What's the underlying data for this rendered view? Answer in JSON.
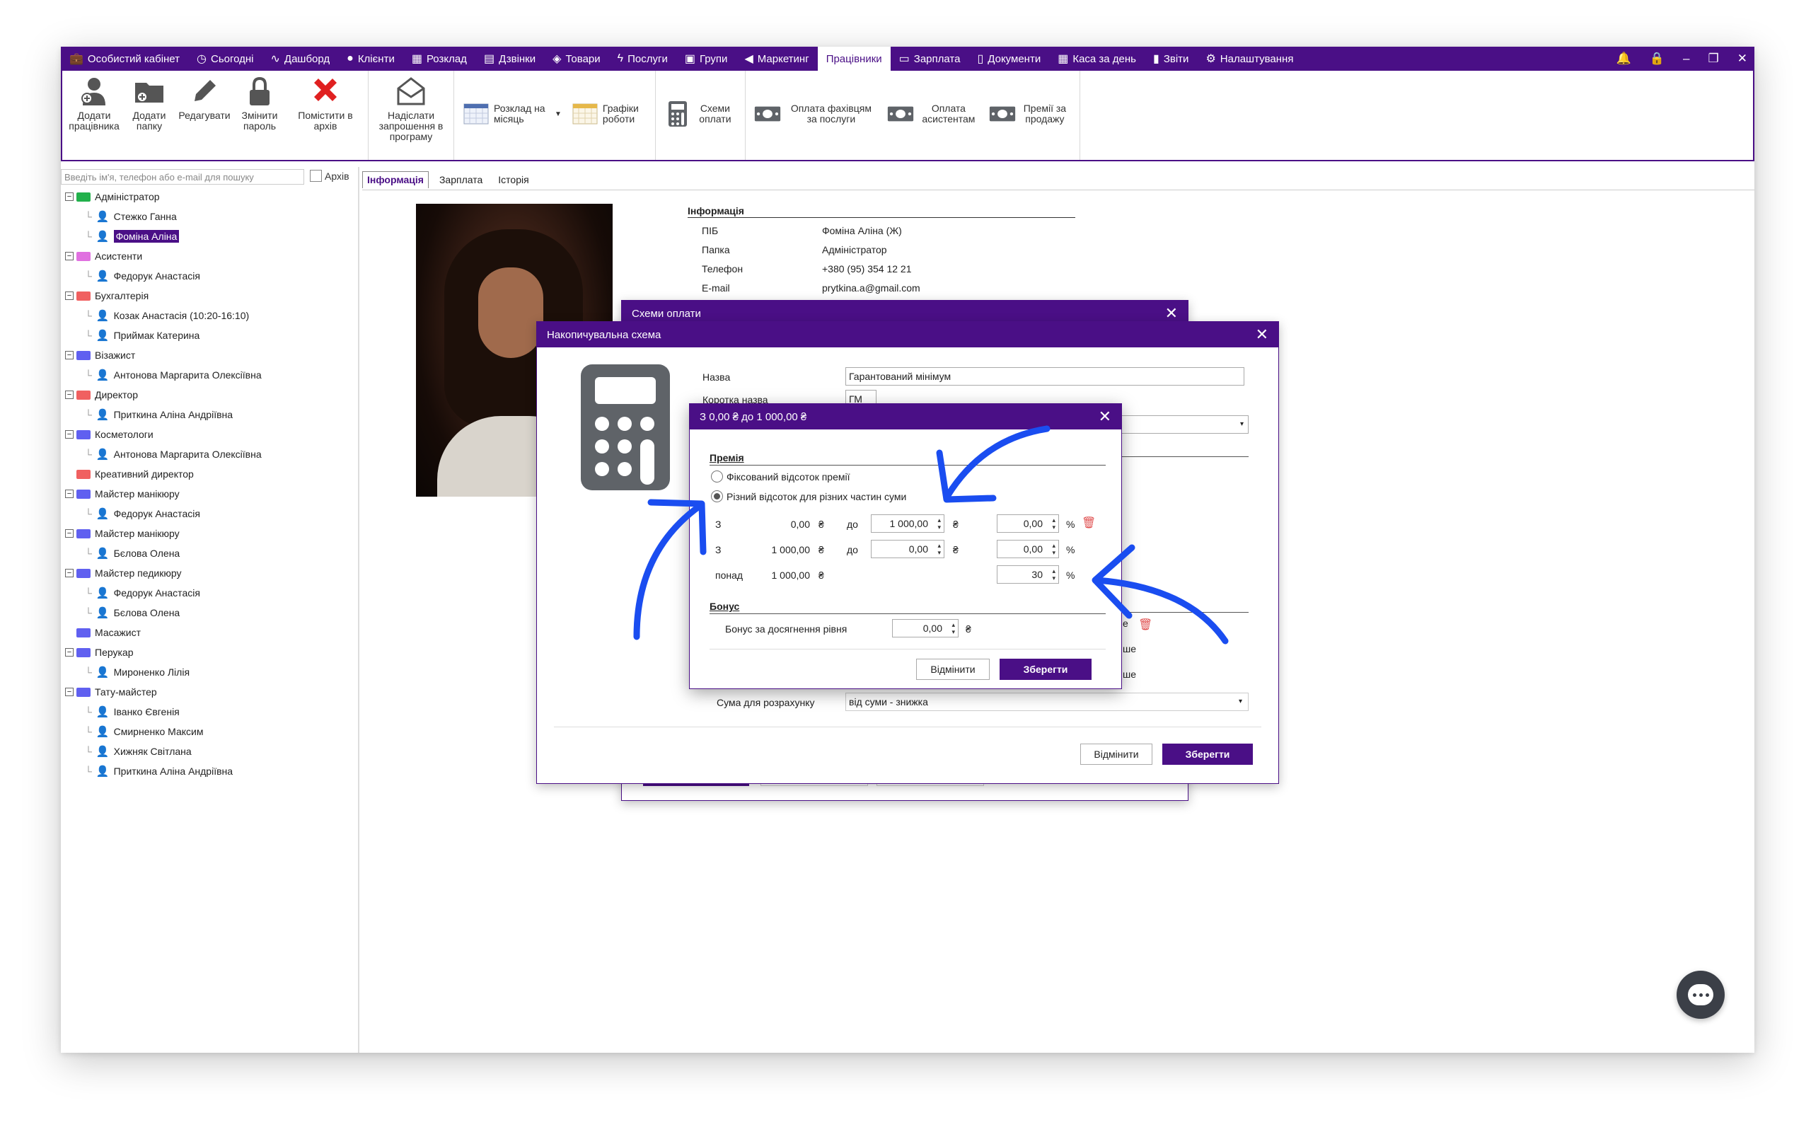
{
  "colors": {
    "accent": "#4a0f86",
    "arrow": "#1a4df0",
    "delete": "#e05050"
  },
  "nav": {
    "tabs": [
      {
        "label": "Особистий кабінет",
        "icon": "briefcase-icon"
      },
      {
        "label": "Сьогодні",
        "icon": "clock-icon"
      },
      {
        "label": "Дашборд",
        "icon": "pulse-icon"
      },
      {
        "label": "Клієнти",
        "icon": "user-icon"
      },
      {
        "label": "Розклад",
        "icon": "calendar-icon"
      },
      {
        "label": "Дзвінки",
        "icon": "phone-icon"
      },
      {
        "label": "Товари",
        "icon": "box-icon"
      },
      {
        "label": "Послуги",
        "icon": "bolt-icon"
      },
      {
        "label": "Групи",
        "icon": "groups-icon"
      },
      {
        "label": "Маркетинг",
        "icon": "megaphone-icon"
      },
      {
        "label": "Працівники",
        "icon": "staff-icon"
      },
      {
        "label": "Зарплата",
        "icon": "money-icon"
      },
      {
        "label": "Документи",
        "icon": "document-icon"
      },
      {
        "label": "Каса за день",
        "icon": "calculator-icon"
      },
      {
        "label": "Звіти",
        "icon": "chart-icon"
      },
      {
        "label": "Налаштування",
        "icon": "gear-icon"
      }
    ],
    "active": "Працівники"
  },
  "ribbon": {
    "add_employee": "Додати працівника",
    "add_folder": "Додати папку",
    "edit": "Редагувати",
    "change_password": "Змінити пароль",
    "archive": "Помістити в архів",
    "send_invite": "Надіслати запрошення в програму",
    "monthly_schedule": "Розклад на місяць",
    "work_schedules": "Графіки роботи",
    "pay_schemes": "Схеми оплати",
    "pay_specialists": "Оплата фахівцям за послуги",
    "pay_assistants": "Оплата асистентам",
    "sales_bonuses": "Премії за продажу"
  },
  "sidebar": {
    "search_placeholder": "Введіть ім'я, телефон або e-mail для пошуку",
    "archive_label": "Архів",
    "tree": [
      {
        "folder": "Адміністратор",
        "color": "#22b14c",
        "people": [
          {
            "name": "Стежко Ганна",
            "color": "#22b14c"
          },
          {
            "name": "Фоміна Аліна",
            "color": "#22b14c",
            "selected": true
          }
        ]
      },
      {
        "folder": "Асистенти",
        "color": "#e070e0",
        "people": [
          {
            "name": "Федорук Анастасія",
            "color": "#e070e0"
          }
        ]
      },
      {
        "folder": "Бухгалтерія",
        "color": "#f06060",
        "people": [
          {
            "name": "Козак Анастасія (10:20-16:10)",
            "color": "#f06060"
          },
          {
            "name": "Приймак Катерина",
            "color": "#f06060"
          }
        ]
      },
      {
        "folder": "Візажист",
        "color": "#6060f0",
        "people": [
          {
            "name": "Антонова Маргарита Олексіївна",
            "color": "#6060f0"
          }
        ]
      },
      {
        "folder": "Директор",
        "color": "#f06060",
        "people": [
          {
            "name": "Приткина Аліна Андріївна",
            "color": "#f06060"
          }
        ]
      },
      {
        "folder": "Косметологи",
        "color": "#6060f0",
        "people": [
          {
            "name": "Антонова Маргарита Олексіївна",
            "color": "#6060f0"
          }
        ]
      },
      {
        "folder": "Креативний директор",
        "color": "#f06060",
        "people": []
      },
      {
        "folder": "Майстер манікюру",
        "color": "#6060f0",
        "people": [
          {
            "name": "Федорук Анастасія",
            "color": "#6060f0"
          }
        ]
      },
      {
        "folder": "Майстер манікюру",
        "color": "#6060f0",
        "people": [
          {
            "name": "Бєлова Олена",
            "color": "#6060f0"
          }
        ]
      },
      {
        "folder": "Майстер педикюру",
        "color": "#6060f0",
        "people": [
          {
            "name": "Федорук Анастасія",
            "color": "#6060f0"
          },
          {
            "name": "Бєлова Олена",
            "color": "#6060f0"
          }
        ]
      },
      {
        "folder": "Масажист",
        "color": "#6060f0",
        "people": []
      },
      {
        "folder": "Перукар",
        "color": "#6060f0",
        "people": [
          {
            "name": "Мироненко Лілія",
            "color": "#6060f0"
          }
        ]
      },
      {
        "folder": "Тату-майстер",
        "color": "#6060f0",
        "people": [
          {
            "name": "Іванко Євгенія",
            "color": "#6060f0"
          },
          {
            "name": "Смирненко Максим",
            "color": "#6060f0"
          },
          {
            "name": "Хижняк Світлана",
            "color": "#6060f0"
          },
          {
            "name": "Приткина Аліна Андріївна",
            "color": "#6060f0"
          }
        ]
      }
    ]
  },
  "content_tabs": [
    "Інформація",
    "Зарплата",
    "Історія"
  ],
  "info": {
    "title": "Інформація",
    "rows": [
      {
        "label": "ПІБ",
        "value": "Фоміна Аліна (Ж)"
      },
      {
        "label": "Папка",
        "value": "Адміністратор"
      },
      {
        "label": "Телефон",
        "value": "+380 (95) 354 12 21"
      },
      {
        "label": "E-mail",
        "value": "prytkina.a@gmail.com"
      }
    ]
  },
  "dlg_schemes": {
    "title": "Схеми оплати"
  },
  "dlg_cumulative": {
    "title": "Накопичувальна схема",
    "name_label": "Назва",
    "name_value": "Гарантований мінімум",
    "short_label": "Коротка назва",
    "short_value": "ГМ",
    "sum_label": "Сума для розрахунку",
    "sum_value": "від суми - знижка",
    "cancel": "Відмінити",
    "save": "Зберегти",
    "partial": [
      "е",
      "ше",
      "ше"
    ]
  },
  "dlg_range": {
    "title": "З 0,00 ₴ до 1 000,00 ₴",
    "premium_header": "Премія",
    "radio_fixed": "Фіксований відсоток премії",
    "radio_diff": "Різний відсоток для різних частин суми",
    "rows": [
      {
        "prefix": "З",
        "from": "0,00",
        "cur": "₴",
        "to_label": "до",
        "to": "1 000,00",
        "pct": "0,00",
        "pct_sign": "%"
      },
      {
        "prefix": "З",
        "from": "1 000,00",
        "cur": "₴",
        "to_label": "до",
        "to": "0,00",
        "pct": "0,00",
        "pct_sign": "%"
      },
      {
        "prefix": "понад",
        "from": "1 000,00",
        "cur": "₴",
        "pct": "30",
        "pct_sign": "%"
      }
    ],
    "bonus_header": "Бонус",
    "bonus_label": "Бонус за досягнення рівня",
    "bonus_value": "0,00",
    "bonus_cur": "₴",
    "cancel": "Відмінити",
    "save": "Зберегти"
  }
}
